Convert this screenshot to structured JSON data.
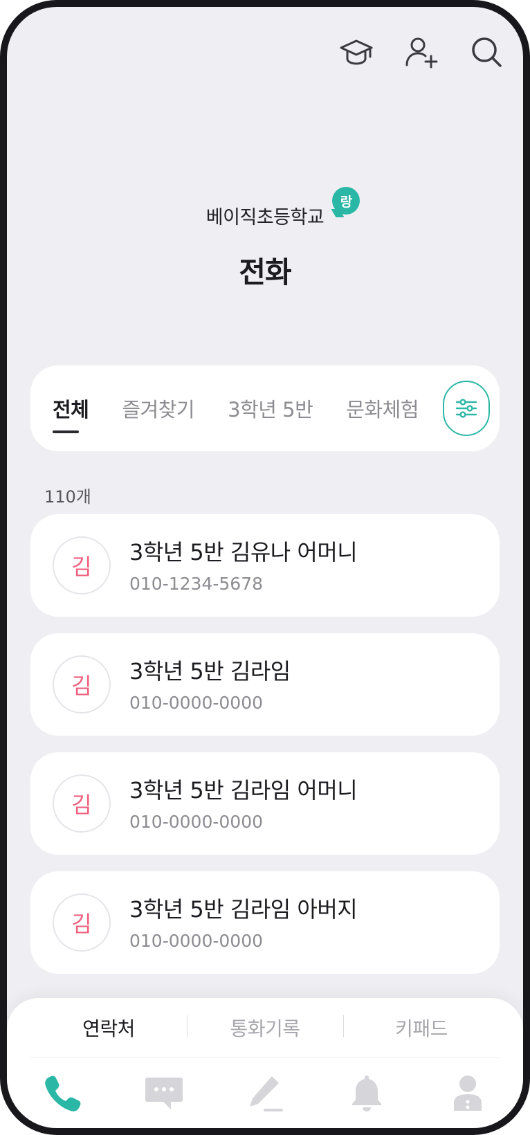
{
  "header": {
    "school_name": "베이직초등학교",
    "school_badge": "랑",
    "title": "전화"
  },
  "top_icons": [
    "graduation-cap-icon",
    "add-user-icon",
    "search-icon"
  ],
  "tabs": [
    {
      "label": "전체",
      "active": true
    },
    {
      "label": "즐겨찾기",
      "active": false
    },
    {
      "label": "3학년 5반",
      "active": false
    },
    {
      "label": "문화체험",
      "active": false
    }
  ],
  "count_label": "110개",
  "contacts": [
    {
      "initial": "김",
      "name": "3학년 5반 김유나 어머니",
      "phone": "010-1234-5678"
    },
    {
      "initial": "김",
      "name": "3학년 5반 김라임",
      "phone": "010-0000-0000"
    },
    {
      "initial": "김",
      "name": "3학년 5반 김라임 어머니",
      "phone": "010-0000-0000"
    },
    {
      "initial": "김",
      "name": "3학년 5반 김라임 아버지",
      "phone": "010-0000-0000"
    }
  ],
  "segments": [
    {
      "label": "연락처",
      "active": true
    },
    {
      "label": "통화기록",
      "active": false
    },
    {
      "label": "키패드",
      "active": false
    }
  ],
  "nav": [
    "phone-icon",
    "message-icon",
    "pen-icon",
    "bell-icon",
    "profile-icon"
  ],
  "colors": {
    "accent": "#2bb7a6",
    "avatar_text": "#f0607f",
    "background": "#efeff3",
    "nav_inactive": "#d6d6da"
  }
}
